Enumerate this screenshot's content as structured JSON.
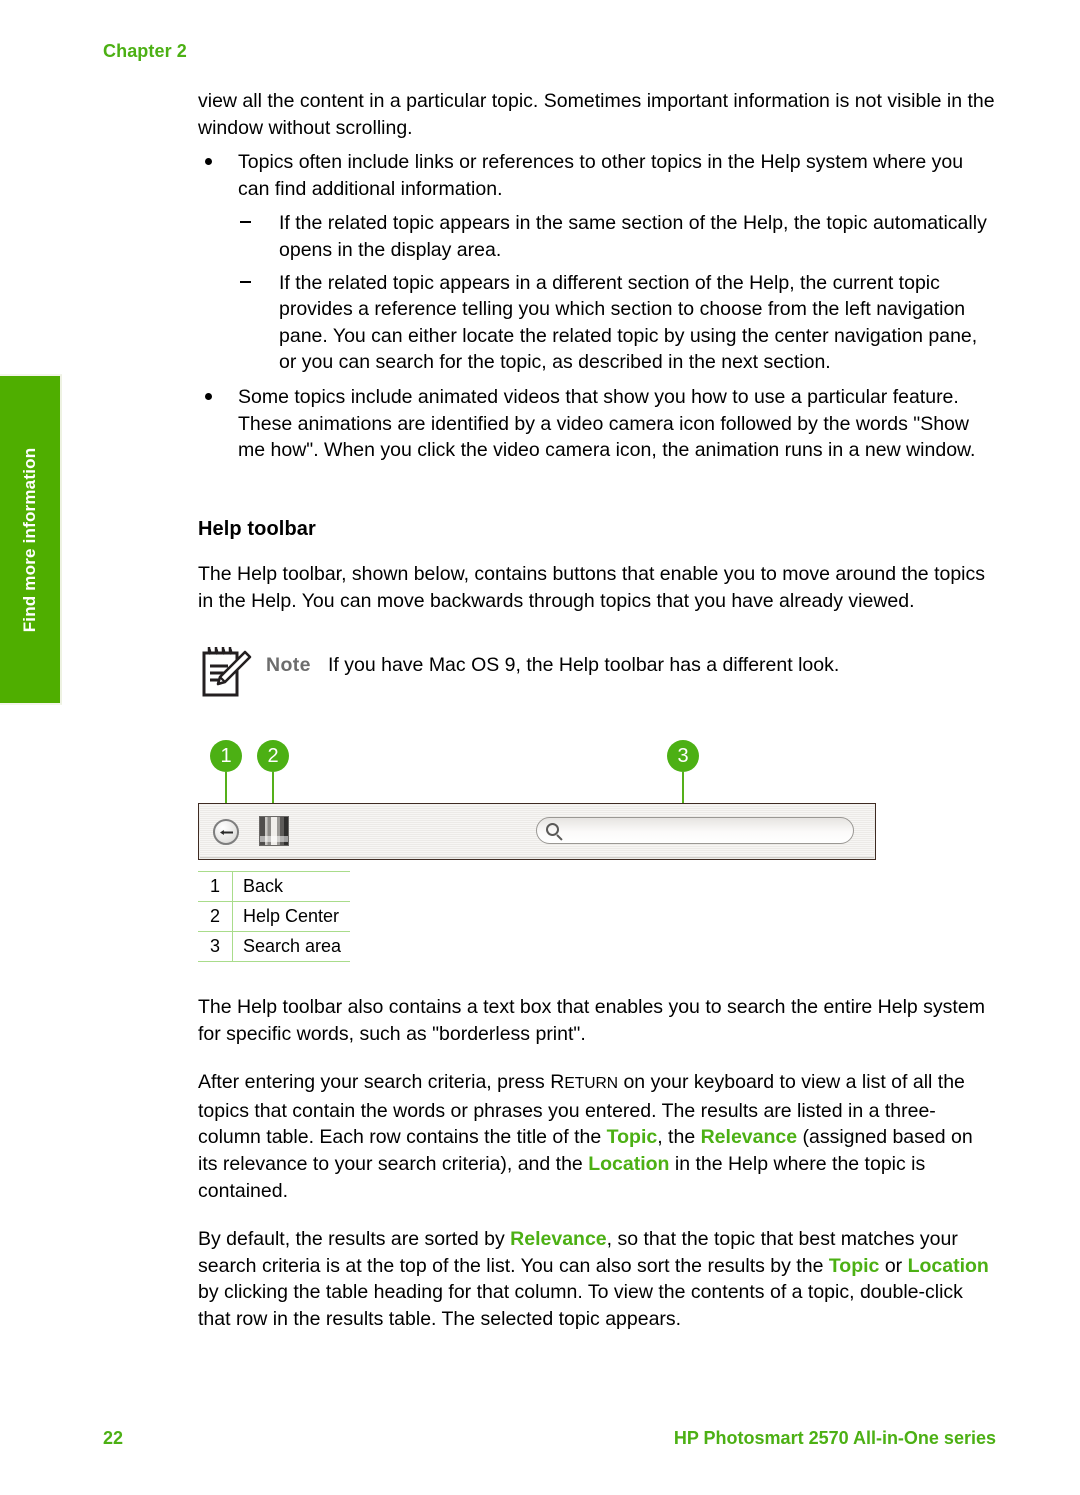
{
  "page": {
    "chapter_label": "Chapter 2",
    "number": "22",
    "book_title": "HP Photosmart 2570 All-in-One series"
  },
  "side_tab": {
    "label": "Find more information",
    "color": "#4fae00"
  },
  "body": {
    "intro_continuation": "view all the content in a particular topic. Sometimes important information is not visible in the window without scrolling.",
    "bullets": [
      {
        "text": "Topics often include links or references to other topics in the Help system where you can find additional information.",
        "sub_items": [
          "If the related topic appears in the same section of the Help, the topic automatically opens in the display area.",
          "If the related topic appears in a different section of the Help, the current topic provides a reference telling you which section to choose from the left navigation pane. You can either locate the related topic by using the center navigation pane, or you can search for the topic, as described in the next section."
        ]
      },
      {
        "text": "Some topics include animated videos that show you how to use a particular feature. These animations are identified by a video camera icon followed by the words \"Show me how\". When you click the video camera icon, the animation runs in a new window.",
        "sub_items": []
      }
    ],
    "section_heading": "Help toolbar",
    "para_toolbar_intro": "The Help toolbar, shown below, contains buttons that enable you to move around the topics in the Help. You can move backwards through topics that you have already viewed."
  },
  "note": {
    "label": "Note",
    "text": "If you have Mac OS 9, the Help toolbar has a different look.",
    "icon": "notepad-pencil-icon"
  },
  "figure": {
    "callouts": [
      {
        "number": "1",
        "target": "back-button"
      },
      {
        "number": "2",
        "target": "help-center-button"
      },
      {
        "number": "3",
        "target": "search-area"
      }
    ],
    "toolbar": {
      "back_icon": "back-arrow-icon",
      "help_center_icon": "help-center-icon",
      "search_icon": "search-icon",
      "search_value": ""
    },
    "legend": [
      {
        "num": "1",
        "label": "Back"
      },
      {
        "num": "2",
        "label": "Help Center"
      },
      {
        "num": "3",
        "label": "Search area"
      }
    ]
  },
  "closing": {
    "para_searchbox_1": "The Help toolbar also contains a text box that enables you to search the entire Help system for specific words, such as \"borderless print\".",
    "para_return_a": "After entering your search criteria, press ",
    "key_return_first": "R",
    "key_return_rest": "ETURN",
    "para_return_b": " on your keyboard to view a list of all the topics that contain the words or phrases you entered. The results are listed in a three-column table. Each row contains the title of the ",
    "kw_topic": "Topic",
    "para_return_c": ", the ",
    "kw_relevance": "Relevance",
    "para_return_d": " (assigned based on its relevance to your search criteria), and the ",
    "kw_location": "Location",
    "para_return_e": " in the Help where the topic is contained.",
    "para_sort_a": "By default, the results are sorted by ",
    "kw_relevance2": "Relevance",
    "para_sort_b": ", so that the topic that best matches your search criteria is at the top of the list. You can also sort the results by the ",
    "kw_topic2": "Topic",
    "para_sort_c": " or ",
    "kw_location2": "Location",
    "para_sort_d": " by clicking the table heading for that column. To view the contents of a topic, double-click that row in the results table. The selected topic appears."
  },
  "colors": {
    "brand_green": "#4cb014",
    "tab_green": "#4fae00",
    "rule_green": "#a9dc8b",
    "note_gray": "#6d6d6d"
  }
}
